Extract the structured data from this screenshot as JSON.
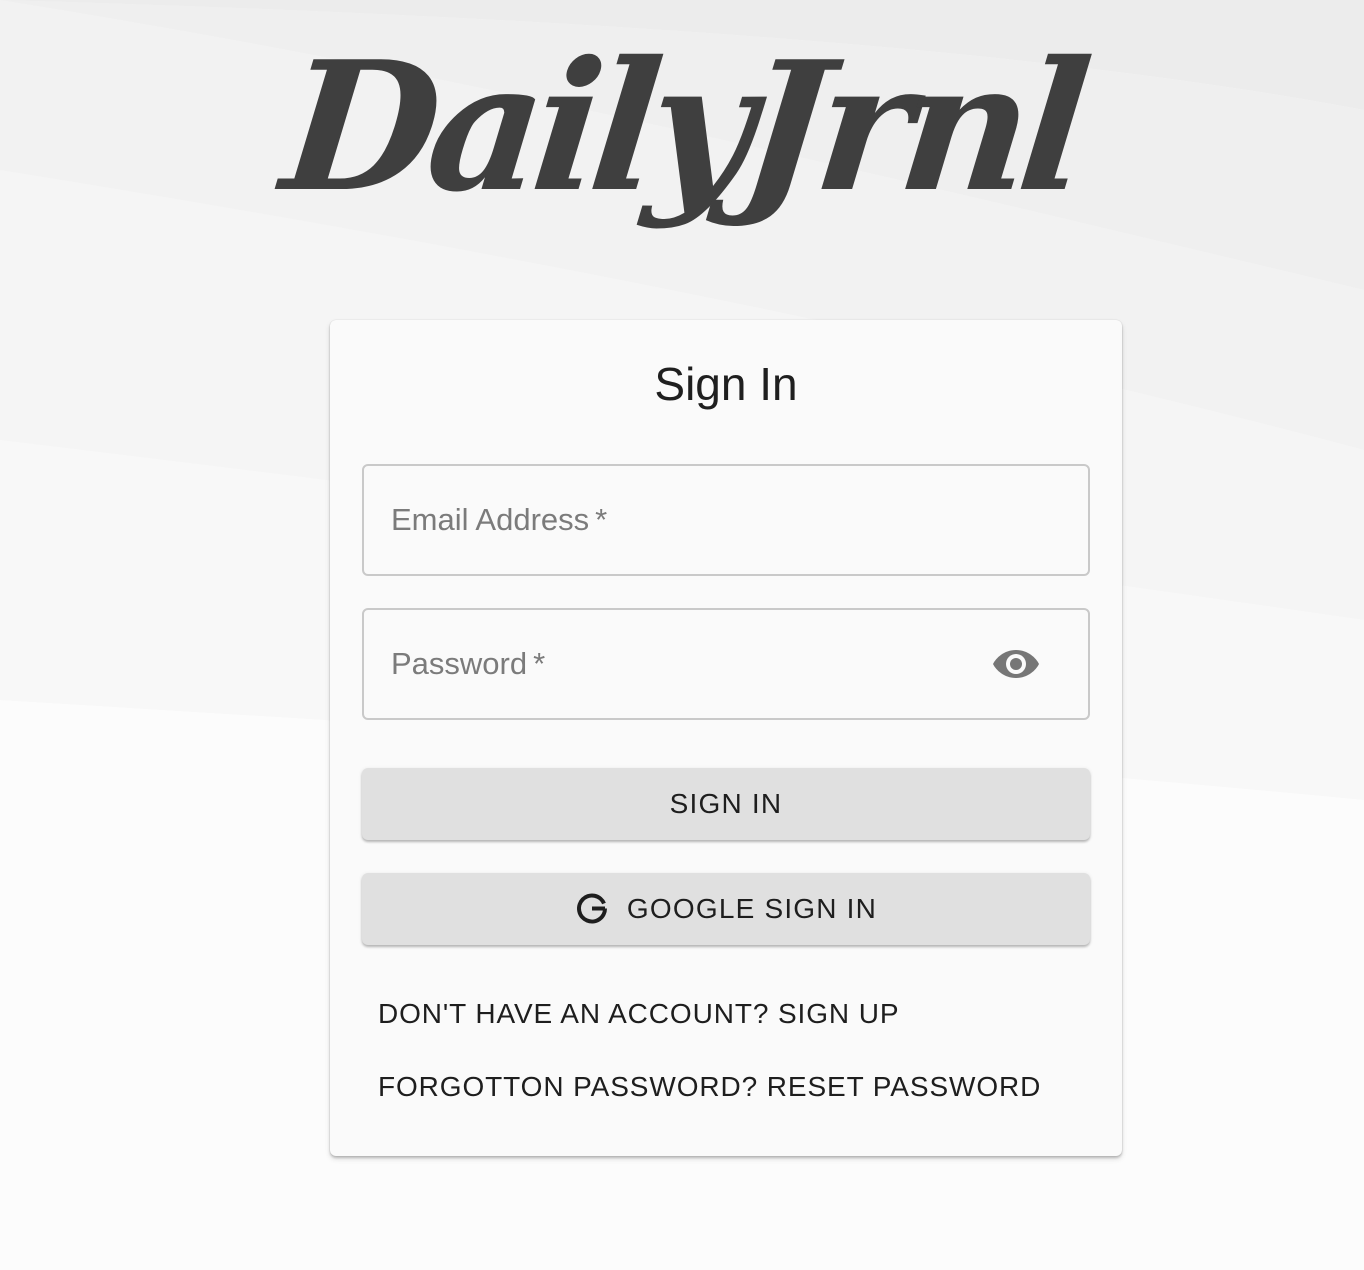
{
  "app": {
    "logo_text": "DailyJrnl"
  },
  "form": {
    "title": "Sign In",
    "email": {
      "label": "Email Address",
      "required_mark": "*",
      "value": ""
    },
    "password": {
      "label": "Password",
      "required_mark": "*",
      "value": "",
      "toggle_icon": "eye-icon"
    },
    "sign_in_label": "SIGN IN",
    "google_sign_in_label": "GOOGLE SIGN IN",
    "google_icon": "google-icon",
    "signup_link": "DON'T HAVE AN ACCOUNT? SIGN UP",
    "reset_link": "FORGOTTON PASSWORD? RESET PASSWORD"
  },
  "colors": {
    "logo": "#3f3f3f",
    "card_bg": "#fafafa",
    "button_bg": "#e0e0e0",
    "label_text": "#7b7b7b"
  }
}
